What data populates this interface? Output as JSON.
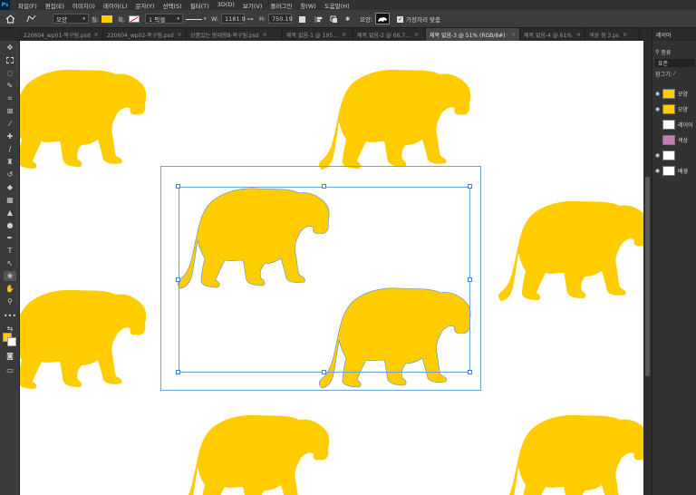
{
  "app": {
    "logo": "Ps"
  },
  "menu": [
    "파일(F)",
    "편집(E)",
    "이미지(I)",
    "레이어(L)",
    "문자(Y)",
    "선택(S)",
    "필터(T)",
    "3D(D)",
    "보기(V)",
    "플러그인",
    "창(W)",
    "도움말(H)"
  ],
  "options": {
    "home_icon": "home-icon",
    "shape_mode": "모양",
    "fill_label": "칠:",
    "fill_color": "#ffcc00",
    "stroke_label": "획:",
    "stroke_width": "1 픽셀",
    "w_label": "W:",
    "w_value": "1181.9",
    "h_label": "H:",
    "h_value": "750.19",
    "shape_label": "모양:",
    "align_edges_label": "가장자리 맞춤"
  },
  "tabs": [
    {
      "label": "220604_wp01-복구됨.psd",
      "active": false
    },
    {
      "label": "220604_wp02-복구됨.psd",
      "active": false
    },
    {
      "label": "상품있는 범대형8-복구됨.psd",
      "active": false
    },
    {
      "label": "제목 없음-1 @ 195...",
      "active": false
    },
    {
      "label": "제목 없음-2 @ 66.7...",
      "active": false
    },
    {
      "label": "제목 없음-3 @ 51% (RGB/8#) *",
      "active": true
    },
    {
      "label": "제목 없음-4 @ 61%...",
      "active": false
    },
    {
      "label": "색상 형 3.ps",
      "active": false
    }
  ],
  "layers_panel": {
    "title": "레이어",
    "filter_label": "종류",
    "blend_mode": "표준",
    "lock_label": "잠그기:",
    "layers": [
      {
        "name": "모양",
        "visible": true,
        "thumb": "#ffcc00"
      },
      {
        "name": "모양",
        "visible": true,
        "thumb": "#ffcc00"
      },
      {
        "name": "레이어",
        "visible": false,
        "thumb": "#ffffff"
      },
      {
        "name": "색상",
        "visible": false,
        "thumb": "#c77bb6"
      },
      {
        "name": "",
        "visible": true,
        "thumb": "#ffffff"
      },
      {
        "name": "배경",
        "visible": true,
        "thumb": "#ffffff"
      }
    ]
  },
  "canvas": {
    "tiger_color": "#ffcc00",
    "background": "#ffffff"
  }
}
